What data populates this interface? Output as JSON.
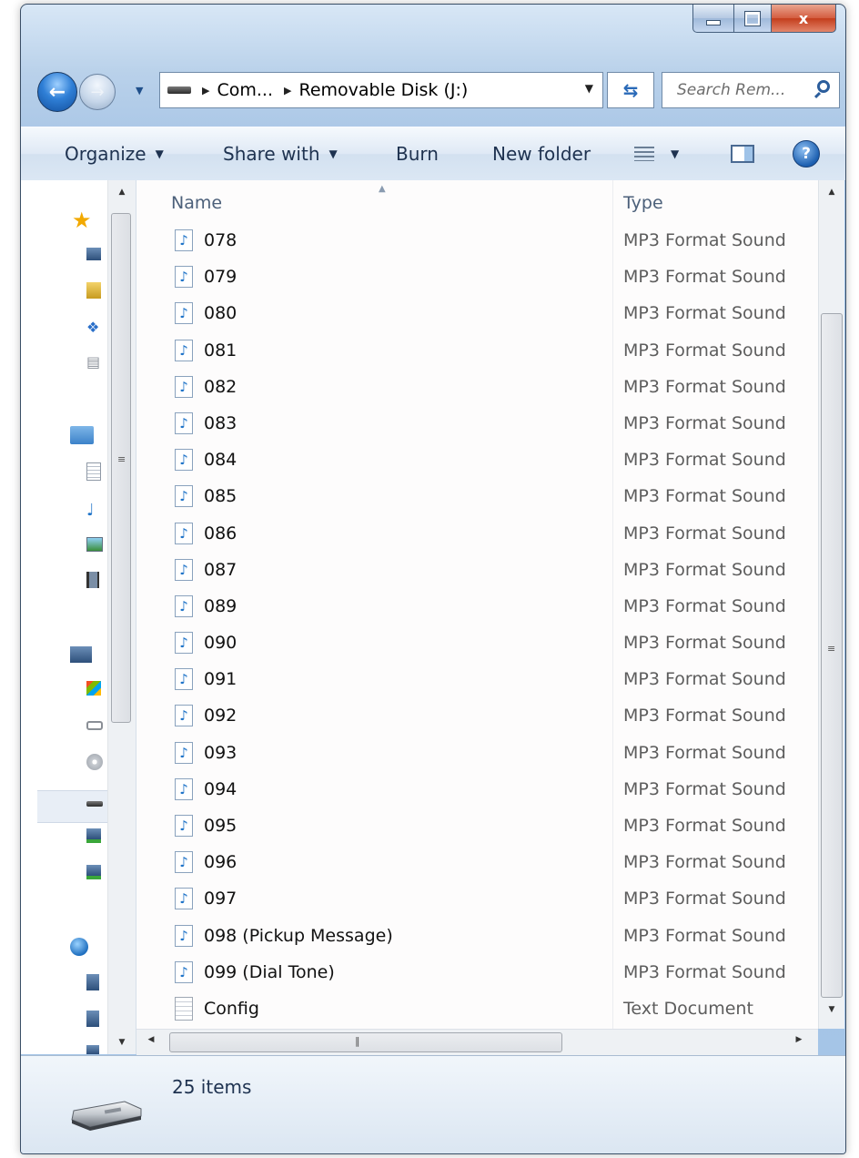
{
  "window": {
    "close_glyph": "x"
  },
  "address": {
    "crumbs": [
      "Com...",
      "Removable Disk (J:)"
    ]
  },
  "search": {
    "placeholder": "Search Rem..."
  },
  "toolbar": {
    "organize": "Organize",
    "share_with": "Share with",
    "burn": "Burn",
    "new_folder": "New folder",
    "help": "?"
  },
  "columns": {
    "name": "Name",
    "type": "Type"
  },
  "files": [
    {
      "name": "078",
      "type": "MP3 Format Sound",
      "kind": "mp3"
    },
    {
      "name": "079",
      "type": "MP3 Format Sound",
      "kind": "mp3"
    },
    {
      "name": "080",
      "type": "MP3 Format Sound",
      "kind": "mp3"
    },
    {
      "name": "081",
      "type": "MP3 Format Sound",
      "kind": "mp3"
    },
    {
      "name": "082",
      "type": "MP3 Format Sound",
      "kind": "mp3"
    },
    {
      "name": "083",
      "type": "MP3 Format Sound",
      "kind": "mp3"
    },
    {
      "name": "084",
      "type": "MP3 Format Sound",
      "kind": "mp3"
    },
    {
      "name": "085",
      "type": "MP3 Format Sound",
      "kind": "mp3"
    },
    {
      "name": "086",
      "type": "MP3 Format Sound",
      "kind": "mp3"
    },
    {
      "name": "087",
      "type": "MP3 Format Sound",
      "kind": "mp3"
    },
    {
      "name": "089",
      "type": "MP3 Format Sound",
      "kind": "mp3"
    },
    {
      "name": "090",
      "type": "MP3 Format Sound",
      "kind": "mp3"
    },
    {
      "name": "091",
      "type": "MP3 Format Sound",
      "kind": "mp3"
    },
    {
      "name": "092",
      "type": "MP3 Format Sound",
      "kind": "mp3"
    },
    {
      "name": "093",
      "type": "MP3 Format Sound",
      "kind": "mp3"
    },
    {
      "name": "094",
      "type": "MP3 Format Sound",
      "kind": "mp3"
    },
    {
      "name": "095",
      "type": "MP3 Format Sound",
      "kind": "mp3"
    },
    {
      "name": "096",
      "type": "MP3 Format Sound",
      "kind": "mp3"
    },
    {
      "name": "097",
      "type": "MP3 Format Sound",
      "kind": "mp3"
    },
    {
      "name": "098 (Pickup Message)",
      "type": "MP3 Format Sound",
      "kind": "mp3"
    },
    {
      "name": "099 (Dial Tone)",
      "type": "MP3 Format Sound",
      "kind": "mp3"
    },
    {
      "name": "Config",
      "type": "Text Document",
      "kind": "txt"
    }
  ],
  "status": {
    "item_count": "25 items"
  },
  "icons": {
    "back": "back-arrow-icon",
    "forward": "forward-arrow-icon",
    "refresh": "refresh-icon",
    "search": "search-icon",
    "view": "view-options-icon",
    "preview_pane": "preview-pane-icon",
    "help": "help-icon",
    "music_file": "music-file-icon",
    "text_file": "text-file-icon",
    "drive": "removable-drive-icon"
  },
  "colors": {
    "accent": "#2f7fd6",
    "close": "#c43d1c",
    "file_type_text": "#5d5d5d"
  }
}
